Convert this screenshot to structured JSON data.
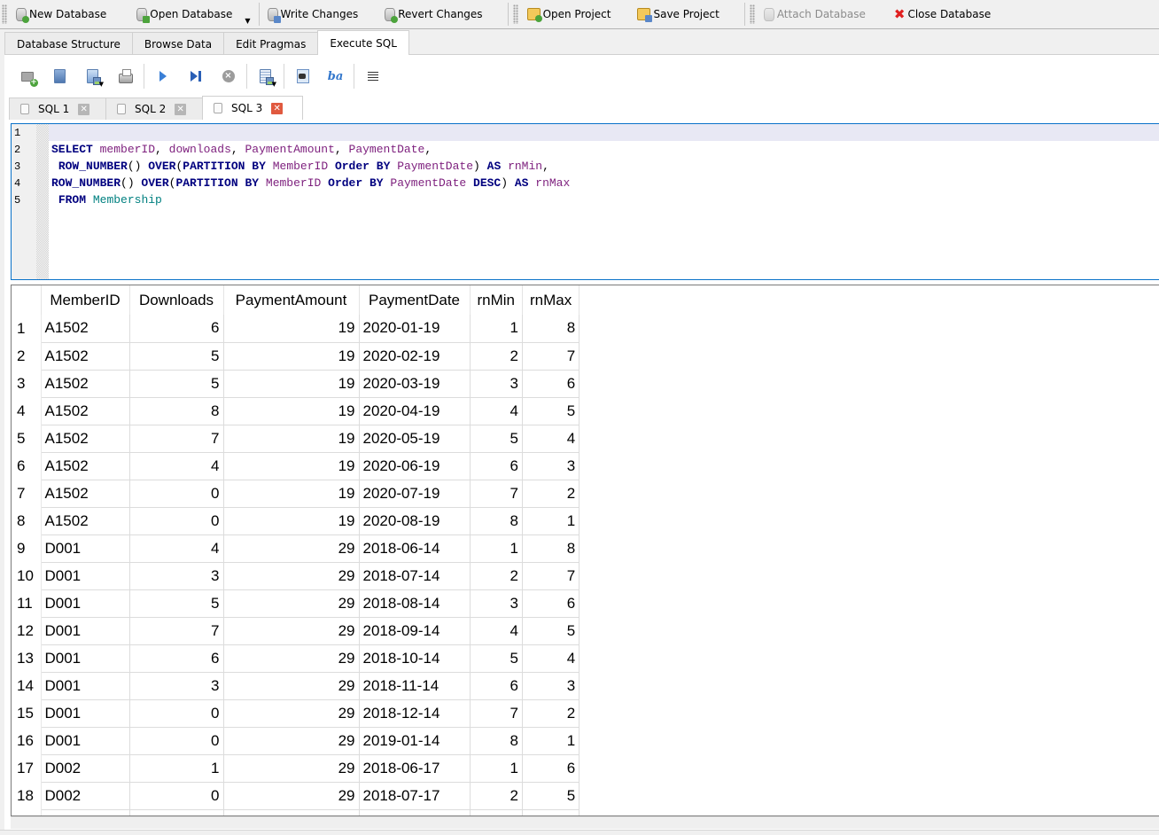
{
  "toolbar": {
    "new_database": "New Database",
    "open_database": "Open Database",
    "write_changes": "Write Changes",
    "revert_changes": "Revert Changes",
    "open_project": "Open Project",
    "save_project": "Save Project",
    "attach_database": "Attach Database",
    "close_database": "Close Database"
  },
  "main_tabs": [
    {
      "label": "Database Structure"
    },
    {
      "label": "Browse Data"
    },
    {
      "label": "Edit Pragmas"
    },
    {
      "label": "Execute SQL",
      "active": true
    }
  ],
  "sql_toolbar": {
    "icons": [
      "open-tab-icon",
      "open-sql-file-icon",
      "save-sql-file-icon",
      "print-icon",
      "execute-all-icon",
      "execute-current-line-icon",
      "stop-execution-icon",
      "save-results-icon",
      "find-text-icon",
      "find-replace-icon",
      "comment-block-icon"
    ]
  },
  "sql_tabs": [
    {
      "label": "SQL 1"
    },
    {
      "label": "SQL 2"
    },
    {
      "label": "SQL 3",
      "active": true
    }
  ],
  "editor": {
    "line_numbers": [
      "1",
      "2",
      "3",
      "4",
      "5"
    ],
    "lines": [
      "",
      "SELECT memberID, downloads, PaymentAmount, PaymentDate,",
      " ROW_NUMBER() OVER(PARTITION BY MemberID Order BY PaymentDate) AS rnMin,",
      "ROW_NUMBER() OVER(PARTITION BY MemberID Order BY PaymentDate DESC) AS rnMax",
      " FROM Membership"
    ]
  },
  "results": {
    "columns": [
      "MemberID",
      "Downloads",
      "PaymentAmount",
      "PaymentDate",
      "rnMin",
      "rnMax"
    ],
    "rows": [
      {
        "n": "1",
        "cells": [
          "A1502",
          "6",
          "19",
          "2020-01-19",
          "1",
          "8"
        ]
      },
      {
        "n": "2",
        "cells": [
          "A1502",
          "5",
          "19",
          "2020-02-19",
          "2",
          "7"
        ]
      },
      {
        "n": "3",
        "cells": [
          "A1502",
          "5",
          "19",
          "2020-03-19",
          "3",
          "6"
        ]
      },
      {
        "n": "4",
        "cells": [
          "A1502",
          "8",
          "19",
          "2020-04-19",
          "4",
          "5"
        ]
      },
      {
        "n": "5",
        "cells": [
          "A1502",
          "7",
          "19",
          "2020-05-19",
          "5",
          "4"
        ]
      },
      {
        "n": "6",
        "cells": [
          "A1502",
          "4",
          "19",
          "2020-06-19",
          "6",
          "3"
        ]
      },
      {
        "n": "7",
        "cells": [
          "A1502",
          "0",
          "19",
          "2020-07-19",
          "7",
          "2"
        ]
      },
      {
        "n": "8",
        "cells": [
          "A1502",
          "0",
          "19",
          "2020-08-19",
          "8",
          "1"
        ]
      },
      {
        "n": "9",
        "cells": [
          "D001",
          "4",
          "29",
          "2018-06-14",
          "1",
          "8"
        ]
      },
      {
        "n": "10",
        "cells": [
          "D001",
          "3",
          "29",
          "2018-07-14",
          "2",
          "7"
        ]
      },
      {
        "n": "11",
        "cells": [
          "D001",
          "5",
          "29",
          "2018-08-14",
          "3",
          "6"
        ]
      },
      {
        "n": "12",
        "cells": [
          "D001",
          "7",
          "29",
          "2018-09-14",
          "4",
          "5"
        ]
      },
      {
        "n": "13",
        "cells": [
          "D001",
          "6",
          "29",
          "2018-10-14",
          "5",
          "4"
        ]
      },
      {
        "n": "14",
        "cells": [
          "D001",
          "3",
          "29",
          "2018-11-14",
          "6",
          "3"
        ]
      },
      {
        "n": "15",
        "cells": [
          "D001",
          "0",
          "29",
          "2018-12-14",
          "7",
          "2"
        ]
      },
      {
        "n": "16",
        "cells": [
          "D001",
          "0",
          "29",
          "2019-01-14",
          "8",
          "1"
        ]
      },
      {
        "n": "17",
        "cells": [
          "D002",
          "1",
          "29",
          "2018-06-17",
          "1",
          "6"
        ]
      },
      {
        "n": "18",
        "cells": [
          "D002",
          "0",
          "29",
          "2018-07-17",
          "2",
          "5"
        ]
      }
    ]
  },
  "colors": {
    "editor_border": "#0a72c9",
    "keyword": "#00007f",
    "identifier": "#7d1f7d",
    "table_name": "#008080",
    "close_icon": "#e02020"
  }
}
